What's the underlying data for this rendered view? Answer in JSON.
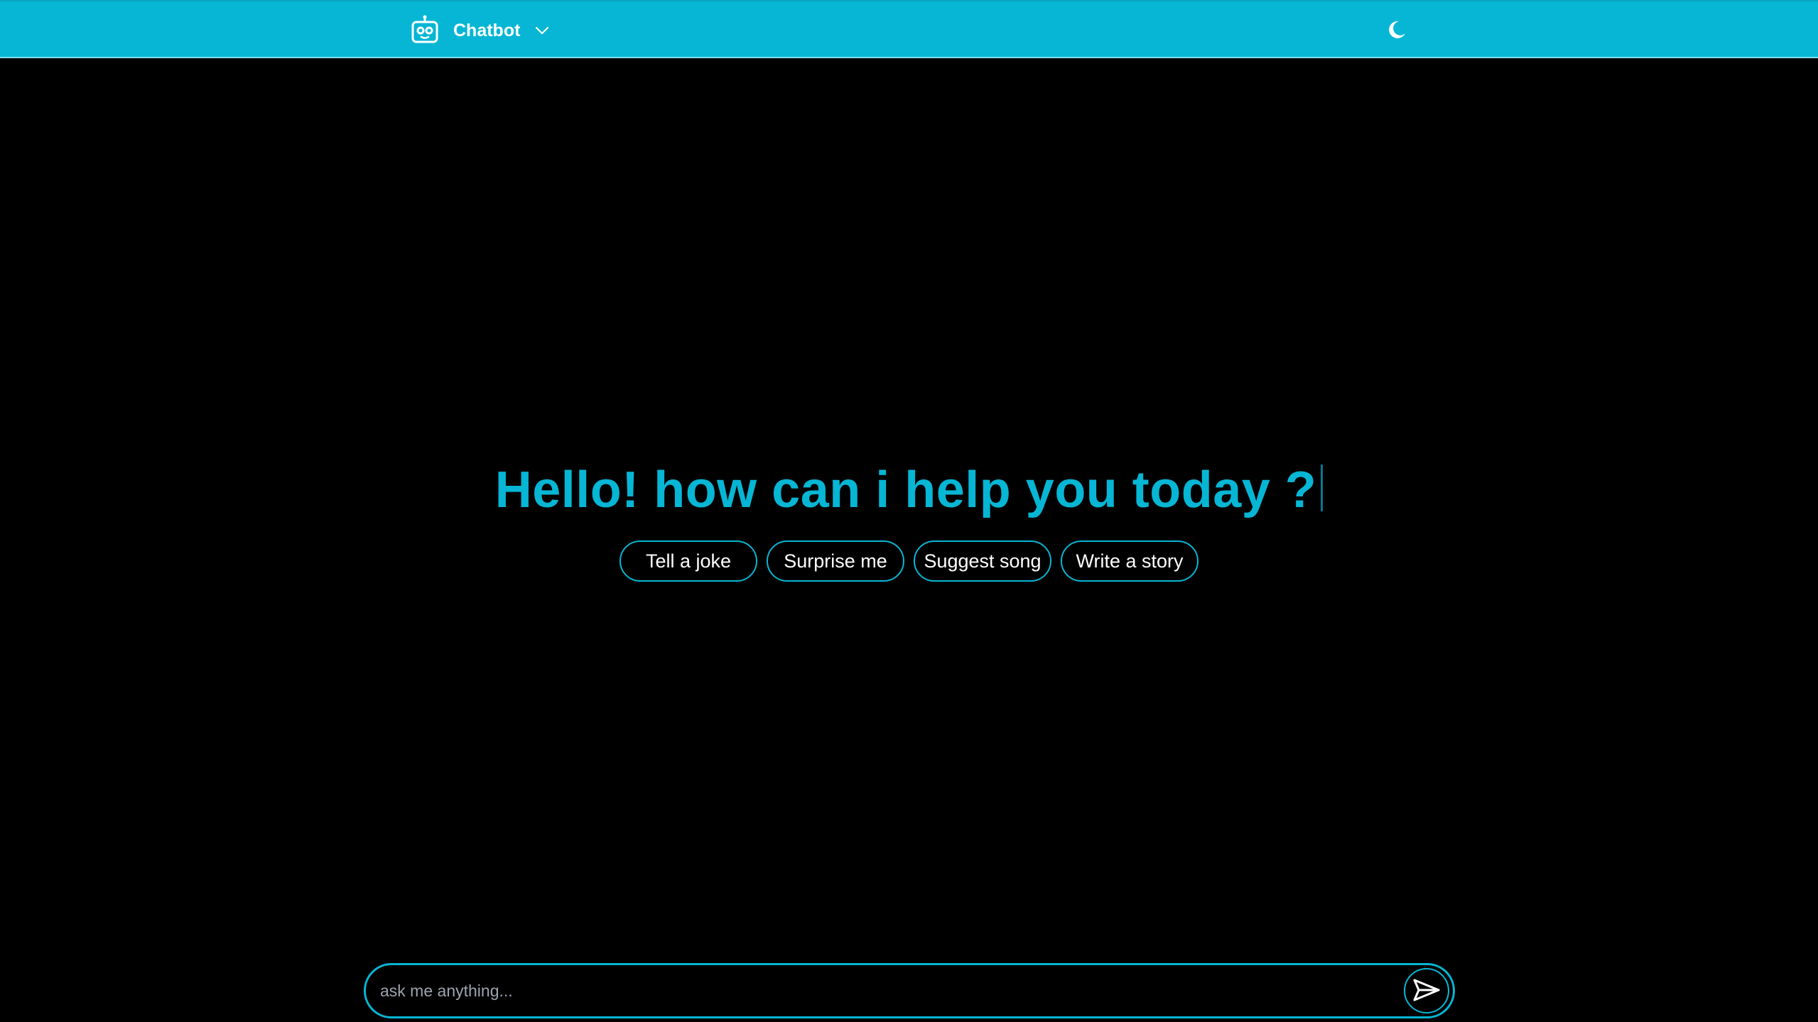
{
  "app": {
    "name": "Chatbot",
    "icons": {
      "brand": "robot-icon",
      "menu": "chevron-down-icon",
      "theme": "moon-icon",
      "send": "send-icon"
    },
    "colors": {
      "accent": "#06b6d4",
      "background": "#000000",
      "text": "#ffffff",
      "placeholder": "#9ca3af"
    }
  },
  "hero": {
    "title": "Hello! how can i help you today ?"
  },
  "suggestions": [
    {
      "label": "Tell a joke"
    },
    {
      "label": "Surprise me"
    },
    {
      "label": "Suggest song"
    },
    {
      "label": "Write a story"
    }
  ],
  "composer": {
    "value": "",
    "placeholder": "ask me anything..."
  }
}
